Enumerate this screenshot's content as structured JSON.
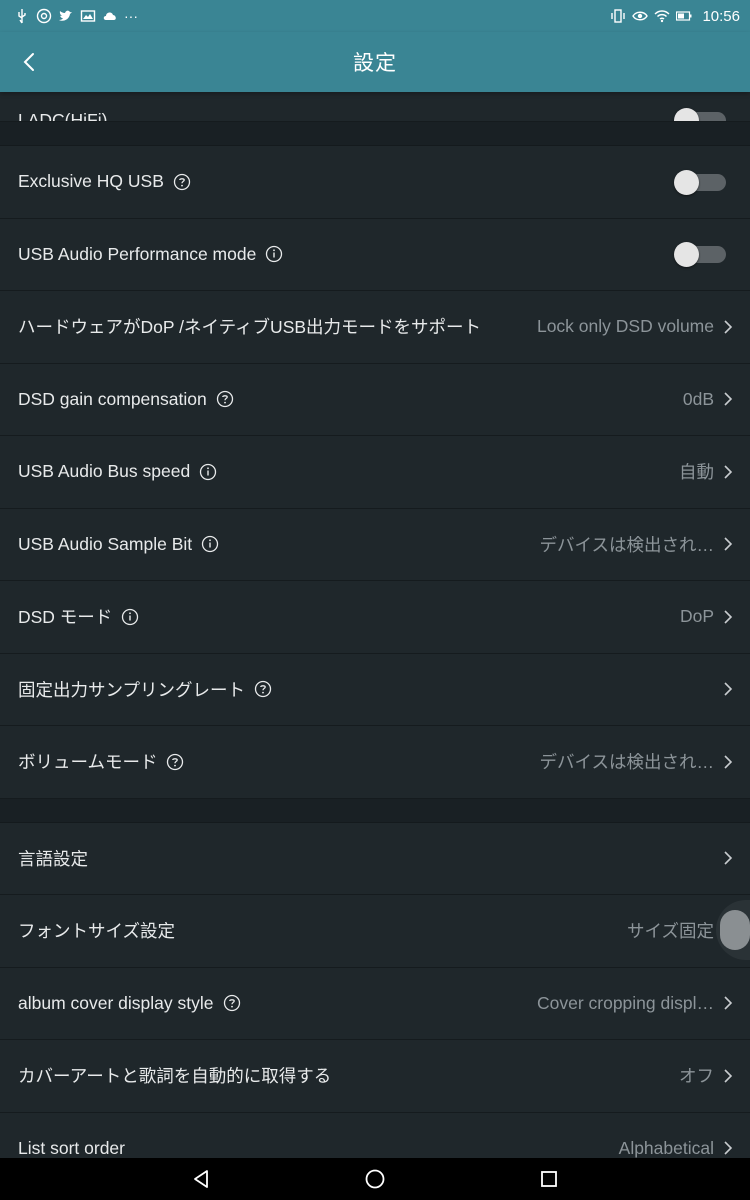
{
  "status_bar": {
    "time": "10:56",
    "dots": "···",
    "left_icons": [
      "usb-icon",
      "at-sign-icon",
      "twitter-icon",
      "photo-icon",
      "cloud-icon"
    ],
    "right_icons": [
      "vibrate-icon",
      "eye-icon",
      "wifi-icon",
      "battery-icon"
    ]
  },
  "app_bar": {
    "title": "設定"
  },
  "settings": {
    "partial_top": {
      "label": "LADC(HiFi)"
    },
    "exclusive_hq_usb": {
      "label": "Exclusive HQ USB",
      "toggle": false
    },
    "usb_audio_performance": {
      "label": "USB Audio Performance mode",
      "toggle": false
    },
    "hardware_dop": {
      "label": "ハードウェアがDoP /ネイティブUSB出力モードをサポート",
      "value": "Lock only DSD volume"
    },
    "dsd_gain": {
      "label": "DSD gain compensation",
      "value": "0dB"
    },
    "usb_bus_speed": {
      "label": "USB Audio Bus speed",
      "value": "自動"
    },
    "usb_sample_bit": {
      "label": "USB Audio Sample Bit",
      "value": "デバイスは検出され…"
    },
    "dsd_mode": {
      "label": "DSD モード",
      "value": "DoP"
    },
    "fixed_sample_rate": {
      "label": "固定出力サンプリングレート",
      "value": ""
    },
    "volume_mode": {
      "label": "ボリュームモード",
      "value": "デバイスは検出され…"
    },
    "language": {
      "label": "言語設定",
      "value": ""
    },
    "font_size": {
      "label": "フォントサイズ設定",
      "value": "サイズ固定"
    },
    "album_cover_style": {
      "label": "album cover display style",
      "value": "Cover cropping displ…"
    },
    "auto_fetch": {
      "label": "カバーアートと歌詞を自動的に取得する",
      "value": "オフ"
    },
    "list_sort": {
      "label": "List sort order",
      "value": "Alphabetical"
    }
  },
  "colors": {
    "accent": "#3a8594",
    "background": "#1f272b",
    "text_primary": "#e8eaeb",
    "text_secondary": "#8c9499"
  }
}
